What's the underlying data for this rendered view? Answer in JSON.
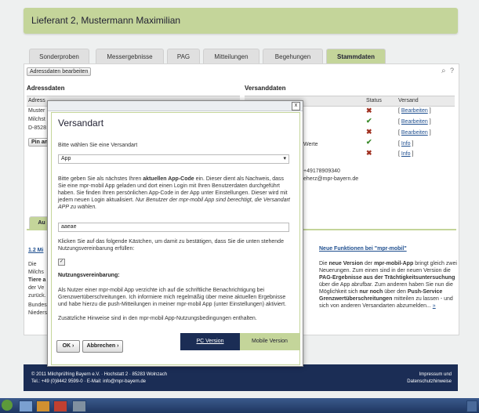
{
  "header": {
    "title": "Lieferant 2, Mustermann Maximilian"
  },
  "tabs": [
    "Sonderproben",
    "Messergebnisse",
    "PAG",
    "Mitteilungen",
    "Begehungen",
    "Stammdaten"
  ],
  "toolbar": {
    "edit_address": "Adressdaten bearbeiten"
  },
  "address": {
    "title": "Adressdaten",
    "col": "Adress",
    "rows": [
      "Muster",
      "Milchst",
      "D-8528"
    ],
    "button": "Pin an"
  },
  "shipping": {
    "title": "Versanddaten",
    "col_status": "Status",
    "col_send": "Versand",
    "rows": [
      {
        "status": "x",
        "link": "Bearbeiten"
      },
      {
        "status": "ok",
        "link": "Bearbeiten"
      },
      {
        "status": "x",
        "link": "Bearbeiten"
      },
      {
        "status": "ok",
        "link": "Info",
        "label": "Werte"
      },
      {
        "status": "x",
        "link": "Info"
      }
    ],
    "phone": "+49178909340",
    "email": "eherz@mpr-bayern.de"
  },
  "lower": {
    "tab": "Au",
    "left_link": "1.2 Mi",
    "left_lines": [
      "Die",
      "Milchs",
      "Tiere a",
      "der Ve",
      "zurück.",
      "Bundes",
      "Nieders"
    ],
    "right_title": "Neue Funktionen bei \"mpr-mobil\"",
    "right_text_1": "Die",
    "right_bold_1": "neue Version",
    "right_text_2": "der",
    "right_bold_2": "mpr-mobil-App",
    "right_text_3": "bringt gleich zwei Neuerungen. Zum einen sind in der neuen Version die",
    "right_bold_3": "PAG-Ergebnisse aus der Trächtigkeitsuntersuchung",
    "right_text_4": "über die App abrufbar. Zum anderen haben Sie nun die Möglichkeit sich",
    "right_bold_4": "nur noch",
    "right_text_5": "über den",
    "right_bold_5": "Push-Service Grenzwertüberschreitungen",
    "right_text_6": "mitteilen zu lassen - und sich von anderen Versandarten abzumelden...",
    "more": "»"
  },
  "dialog": {
    "title": "Versandart",
    "choose_label": "Bitte wählen Sie eine Versandart",
    "select_value": "App",
    "para1_a": "Bitte geben Sie als nächstes Ihren",
    "para1_b": "aktuellen App-Code",
    "para1_c": "ein. Dieser dient als Nachweis, dass Sie eine mpr-mobil App geladen und dort einen Login mit Ihren Benutzerdaten durchgeführt haben. Sie finden Ihren persönlichen App-Code in der App unter Einstellungen. Dieser wird mit jedem neuen Login aktualisiert.",
    "para1_d": "Nur Benutzer der mpr-mobil App sind berechtigt, die Versandart APP zu wählen.",
    "code_value": "aaeae",
    "confirm_text": "Klicken Sie auf das folgende Kästchen, um damit zu bestätigen, dass Sie die unten stehende Nutzungsvereinbarung erfüllen:",
    "checkbox_mark": "✓",
    "terms_title": "Nutzungsvereinbarung:",
    "terms_text": "Als Nutzer einer mpr-mobil App verzichte ich auf die schriftliche Benachrichtigung bei Grenzwertüberschreitungen. Ich informiere mich regelmäßig über meine aktuellen Ergebnisse und habe hierzu die push-Mitteilungen in meiner mpr-mobil App  (unter Einstellungen) aktiviert.",
    "terms_hint": "Zusätzliche Hinweise sind in den mpr-mobil App-Nutzungsbedingungen enthalten.",
    "ok": "OK",
    "cancel": "Abbrechen",
    "pc_version": "PC Version",
    "mobile_version": "Mobile Version",
    "close": "x"
  },
  "footer": {
    "line1": "© 2011 Milchprüfring Bayern e.V. · Hochstatt 2 · 85283 Wolnzach",
    "line2": "Tel.: +49 (0)8442 9599-0 · E-Mail: info@mpr-bayern.de",
    "right1": "Impressum und",
    "right2": "Datenschutzhinweise"
  },
  "colors": {
    "accent": "#c4d59a",
    "footer": "#1b2d55",
    "link": "#1f4f8f"
  }
}
